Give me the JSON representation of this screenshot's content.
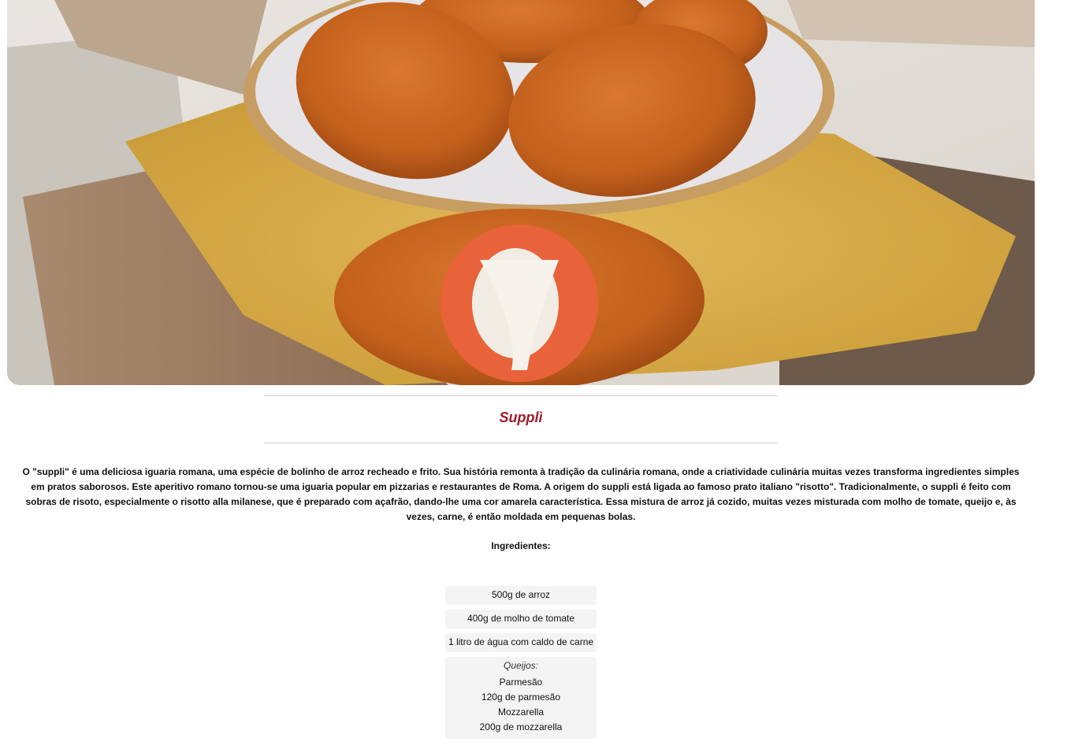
{
  "recipe": {
    "title": "Supplì",
    "description": "O \"suppli\" é uma deliciosa iguaria romana, uma espécie de bolinho de arroz recheado e frito. Sua história remonta à tradição da culinária romana, onde a criatividade culinária muitas vezes transforma ingredientes simples em pratos saborosos. Este aperitivo romano tornou-se uma iguaria popular em pizzarias e restaurantes de Roma. A origem do suppli está ligada ao famoso prato italiano \"risotto\". Tradicionalmente, o suppli é feito com sobras de risoto, especialmente o risotto alla milanese, que é preparado com açafrão, dando-lhe uma cor amarela característica. Essa mistura de arroz já cozido, muitas vezes misturada com molho de tomate, queijo e, às vezes, carne, é então moldada em pequenas bolas.",
    "ingredients_heading": "Ingredientes:",
    "ingredients": [
      "500g de arroz",
      "400g de molho de tomate",
      "1 litro de água com caldo de carne"
    ],
    "cheese_group": {
      "label": "Queijos:",
      "items": [
        "Parmesão",
        "120g de parmesão",
        "Mozzarella",
        "200g de mozzarella"
      ]
    }
  },
  "colors": {
    "title": "#9b1c2c",
    "item_background": "#f4f4f4",
    "rule": "#cfcfcf"
  }
}
